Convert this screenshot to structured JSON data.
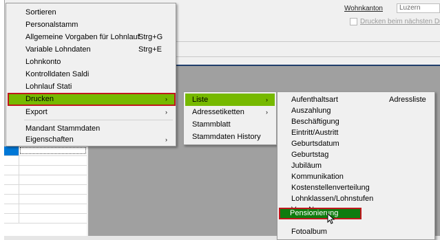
{
  "form": {
    "wohnkanton_label": "Wohnkanton",
    "wohnkanton_value": "Luzern",
    "checkbox_label": "Drucken beim nächsten Druck"
  },
  "main_menu": {
    "items": [
      {
        "label": "Sortieren"
      },
      {
        "label": "Personalstamm"
      },
      {
        "label": "Allgemeine Vorgaben für Lohnlauf",
        "shortcut": "Strg+G"
      },
      {
        "label": "Variable Lohndaten",
        "shortcut": "Strg+E"
      },
      {
        "label": "Lohnkonto"
      },
      {
        "label": "Kontrolldaten Saldi"
      },
      {
        "label": "Lohnlauf Stati"
      },
      {
        "label": "Drucken"
      },
      {
        "label": "Export"
      },
      {
        "label": "Mandant Stammdaten"
      },
      {
        "label": "Eigenschaften"
      }
    ]
  },
  "drucken_menu": {
    "items": [
      {
        "label": "Liste"
      },
      {
        "label": "Adressetiketten"
      },
      {
        "label": "Stammblatt"
      },
      {
        "label": "Stammdaten History"
      }
    ]
  },
  "liste_menu": {
    "items": [
      {
        "label": "Aufenthaltsart",
        "extra": "Adressliste"
      },
      {
        "label": "Auszahlung"
      },
      {
        "label": "Beschäftigung"
      },
      {
        "label": "Eintritt/Austritt"
      },
      {
        "label": "Geburtsdatum"
      },
      {
        "label": "Geburtstag"
      },
      {
        "label": "Jubiläum"
      },
      {
        "label": "Kommunikation"
      },
      {
        "label": "Kostenstellenverteilung"
      },
      {
        "label": "Lohnklassen/Lohnstufen"
      },
      {
        "label": "Vers.Nummer"
      },
      {
        "label": "Pensionierung"
      },
      {
        "label": "Fotoalbum"
      }
    ]
  },
  "icons": {
    "submenu_arrow": "›",
    "cursor": "mouse-pointer-icon"
  },
  "colors": {
    "highlight_green": "#76b900",
    "selected_dark_green": "#0f7c0f",
    "outline_red": "#c0161c",
    "selection_blue": "#0078d7"
  }
}
